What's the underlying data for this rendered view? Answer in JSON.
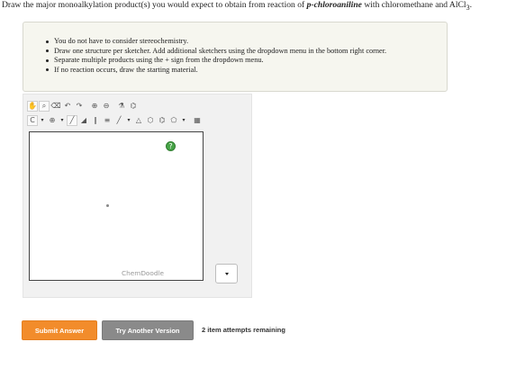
{
  "question": {
    "prefix": "Draw the major monoalkylation product(s) you would expect to obtain from reaction of ",
    "compound": "p-chloroaniline",
    "suffix": " with chloromethane and AlCl",
    "subscript": "3",
    "end": "."
  },
  "instructions": [
    "You do not have to consider stereochemistry.",
    "Draw one structure per sketcher. Add additional sketchers using the dropdown menu in the bottom right corner.",
    "Separate multiple products using the + sign from the dropdown menu.",
    "If no reaction occurs, draw the starting material."
  ],
  "toolbar": {
    "row1": [
      {
        "name": "pan-hand-icon",
        "glyph": "✋"
      },
      {
        "name": "lasso-icon",
        "glyph": "⌕"
      },
      {
        "name": "eraser-icon",
        "glyph": "⌫"
      },
      {
        "name": "undo-icon",
        "glyph": "↶"
      },
      {
        "name": "redo-icon",
        "glyph": "↷"
      },
      {
        "name": "zoom-in-icon",
        "glyph": "⊕"
      },
      {
        "name": "zoom-out-icon",
        "glyph": "⊖"
      },
      {
        "name": "clean-icon",
        "glyph": "⚗"
      },
      {
        "name": "template-icon",
        "glyph": "⌬"
      }
    ],
    "row2": [
      {
        "name": "carbon-atom-icon",
        "glyph": "C"
      },
      {
        "name": "charge-plus-icon",
        "glyph": "⊕"
      },
      {
        "name": "single-bond-icon",
        "glyph": "╱"
      },
      {
        "name": "wedge-bond-icon",
        "glyph": "◢"
      },
      {
        "name": "double-bond-icon",
        "glyph": "∥"
      },
      {
        "name": "triple-bond-icon",
        "glyph": "≡"
      },
      {
        "name": "bond-dropdown-icon",
        "glyph": "╱"
      },
      {
        "name": "cyclopropane-icon",
        "glyph": "△"
      },
      {
        "name": "cyclohexane-icon",
        "glyph": "⬡"
      },
      {
        "name": "benzene-icon",
        "glyph": "⌬"
      },
      {
        "name": "ring-dropdown-icon",
        "glyph": "⬠"
      },
      {
        "name": "periodic-table-icon",
        "glyph": "▦"
      }
    ]
  },
  "canvas": {
    "help_glyph": "?",
    "watermark": "ChemDoodle"
  },
  "actions": {
    "submit": "Submit Answer",
    "try_another": "Try Another Version",
    "attempts": "2 item attempts remaining"
  },
  "colors": {
    "submit": "#f28c2b",
    "try_another": "#8a8a8a",
    "help": "#47a447"
  }
}
